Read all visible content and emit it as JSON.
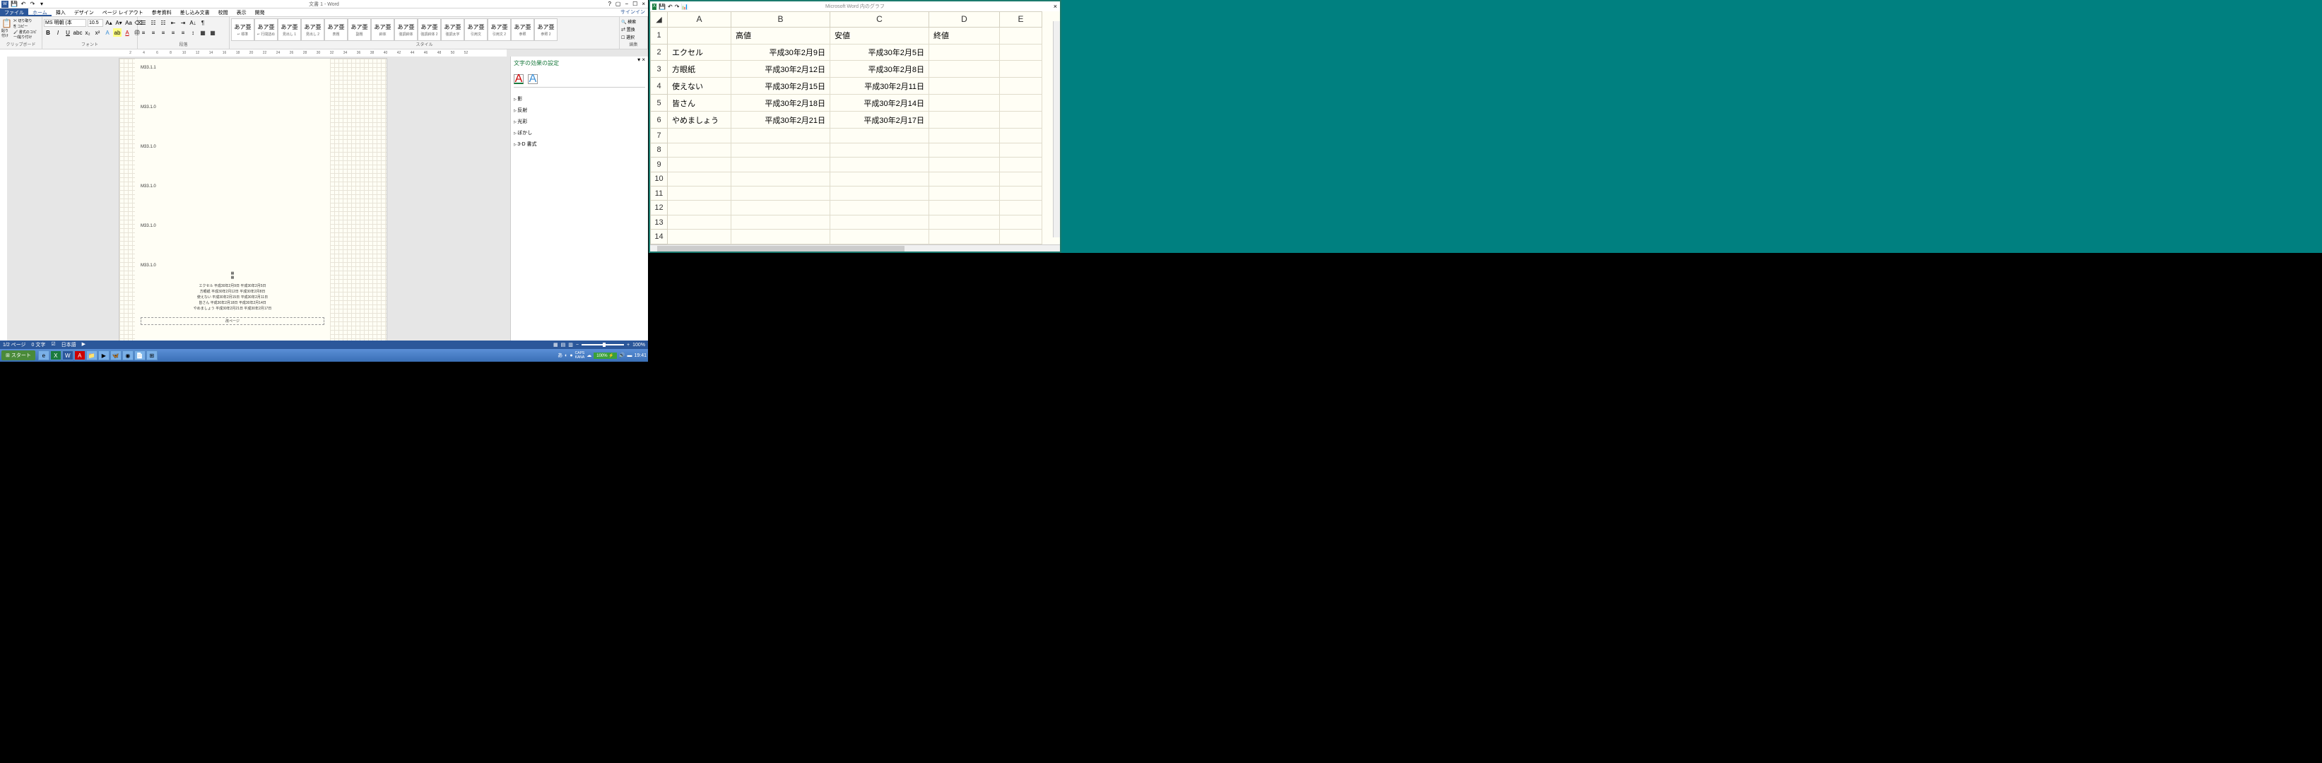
{
  "word": {
    "title": "文書 1 - Word",
    "signin": "サインイン",
    "tabs": {
      "file": "ファイル",
      "home": "ホーム",
      "insert": "挿入",
      "design": "デザイン",
      "layout": "ページ レイアウト",
      "references": "参考資料",
      "mailings": "差し込み文書",
      "review": "校閲",
      "view": "表示",
      "developer": "開発"
    },
    "ribbon": {
      "clipboard": {
        "label": "クリップボード",
        "paste": "貼り付け",
        "cut": "切り取り",
        "copy": "コピー",
        "format": "書式のコピー/貼り付け"
      },
      "font": {
        "label": "フォント",
        "name": "MS 明朝 (本",
        "size": "10.5"
      },
      "paragraph": {
        "label": "段落"
      },
      "styles": {
        "label": "スタイル",
        "items": [
          {
            "preview": "あア亜",
            "name": "↵ 標準"
          },
          {
            "preview": "あア亜",
            "name": "↵ 行間詰め"
          },
          {
            "preview": "あア亜",
            "name": "見出し 1"
          },
          {
            "preview": "あア亜",
            "name": "見出し 2"
          },
          {
            "preview": "あア亜",
            "name": "表題"
          },
          {
            "preview": "あア亜",
            "name": "副題"
          },
          {
            "preview": "あア亜",
            "name": "斜体"
          },
          {
            "preview": "あア亜",
            "name": "強調斜体"
          },
          {
            "preview": "あア亜",
            "name": "強調斜体 2"
          },
          {
            "preview": "あア亜",
            "name": "強調太字"
          },
          {
            "preview": "あア亜",
            "name": "引用文"
          },
          {
            "preview": "あア亜",
            "name": "引用文 2"
          },
          {
            "preview": "あア亜",
            "name": "参照"
          },
          {
            "preview": "あア亜",
            "name": "参照 2"
          }
        ]
      },
      "editing": {
        "label": "編集",
        "find": "検索",
        "replace": "置換",
        "select": "選択"
      }
    },
    "document": {
      "lines": [
        "M33.1.1",
        "M33.1.0",
        "M33.1.0",
        "M33.1.0",
        "M33.1.0",
        "M33.1.0"
      ],
      "table_rows": [
        "エクセル 平成30年2月9日 平成30年2月5日",
        "方眼紙 平成30年2月12日 平成30年2月8日",
        "使えない 平成30年2月15日 平成30年2月11日",
        "皆さん 平成30年2月18日 平成30年2月14日",
        "やめましょう 平成30年2月21日 平成30年2月17日"
      ],
      "page_break": "改ページ"
    },
    "taskpane": {
      "title": "文字の効果の設定",
      "items": [
        "影",
        "反射",
        "光彩",
        "ぼかし",
        "3-D 書式"
      ]
    },
    "statusbar": {
      "page": "1/2 ページ",
      "words": "0 文字",
      "lang": "日本語",
      "zoom": "100%"
    },
    "ruler_marks": [
      "2",
      "4",
      "6",
      "8",
      "10",
      "12",
      "14",
      "16",
      "18",
      "20",
      "22",
      "24",
      "26",
      "28",
      "30",
      "32",
      "34",
      "36",
      "38",
      "40",
      "42",
      "44",
      "46",
      "48",
      "50",
      "52"
    ]
  },
  "taskbar": {
    "start": "スタート",
    "ime": "あ",
    "battery": "100%",
    "time": "19:41"
  },
  "excel": {
    "title": "Microsoft Word 内のグラフ",
    "headers": {
      "A": "A",
      "B": "B",
      "C": "C",
      "D": "D",
      "E": "E"
    },
    "row1": {
      "B": "高値",
      "C": "安値",
      "D": "終値"
    },
    "rows": [
      {
        "n": "2",
        "A": "エクセル",
        "B": "平成30年2月9日",
        "C": "平成30年2月5日"
      },
      {
        "n": "3",
        "A": "方眼紙",
        "B": "平成30年2月12日",
        "C": "平成30年2月8日"
      },
      {
        "n": "4",
        "A": "使えない",
        "B": "平成30年2月15日",
        "C": "平成30年2月11日"
      },
      {
        "n": "5",
        "A": "皆さん",
        "B": "平成30年2月18日",
        "C": "平成30年2月14日"
      },
      {
        "n": "6",
        "A": "やめましょう",
        "B": "平成30年2月21日",
        "C": "平成30年2月17日"
      }
    ],
    "empty_rows": [
      "7",
      "8",
      "9",
      "10",
      "11",
      "12",
      "13",
      "14"
    ]
  },
  "chart_data": {
    "type": "table",
    "title": "Microsoft Word 内のグラフ",
    "columns": [
      "",
      "高値",
      "安値",
      "終値"
    ],
    "series": [
      {
        "name": "エクセル",
        "values": [
          "平成30年2月9日",
          "平成30年2月5日",
          null
        ]
      },
      {
        "name": "方眼紙",
        "values": [
          "平成30年2月12日",
          "平成30年2月8日",
          null
        ]
      },
      {
        "name": "使えない",
        "values": [
          "平成30年2月15日",
          "平成30年2月11日",
          null
        ]
      },
      {
        "name": "皆さん",
        "values": [
          "平成30年2月18日",
          "平成30年2月14日",
          null
        ]
      },
      {
        "name": "やめましょう",
        "values": [
          "平成30年2月21日",
          "平成30年2月17日",
          null
        ]
      }
    ]
  }
}
